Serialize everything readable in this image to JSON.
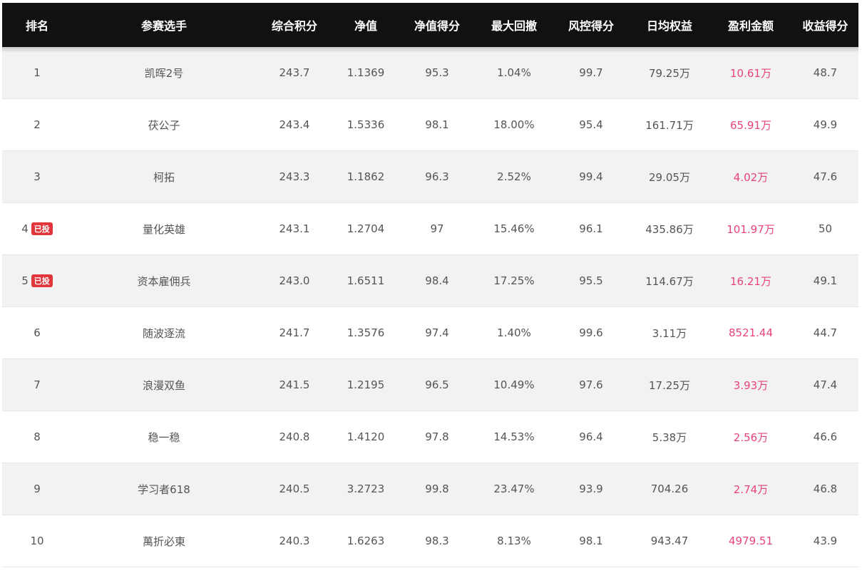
{
  "columns": [
    "排名",
    "参赛选手",
    "综合积分",
    "净值",
    "净值得分",
    "最大回撤",
    "风控得分",
    "日均权益",
    "盈利金额",
    "收益得分"
  ],
  "rows": [
    {
      "rank": "1",
      "badge": "",
      "name": "凯晖2号",
      "score": "243.7",
      "nav": "1.1369",
      "nav_score": "95.3",
      "max_dd": "1.04%",
      "risk_score": "99.7",
      "avg_equity": "79.25万",
      "profit": "10.61万",
      "return_score": "48.7"
    },
    {
      "rank": "2",
      "badge": "",
      "name": "茯公子",
      "score": "243.4",
      "nav": "1.5336",
      "nav_score": "98.1",
      "max_dd": "18.00%",
      "risk_score": "95.4",
      "avg_equity": "161.71万",
      "profit": "65.91万",
      "return_score": "49.9"
    },
    {
      "rank": "3",
      "badge": "",
      "name": "柯拓",
      "score": "243.3",
      "nav": "1.1862",
      "nav_score": "96.3",
      "max_dd": "2.52%",
      "risk_score": "99.4",
      "avg_equity": "29.05万",
      "profit": "4.02万",
      "return_score": "47.6"
    },
    {
      "rank": "4",
      "badge": "已投",
      "name": "量化英雄",
      "score": "243.1",
      "nav": "1.2704",
      "nav_score": "97",
      "max_dd": "15.46%",
      "risk_score": "96.1",
      "avg_equity": "435.86万",
      "profit": "101.97万",
      "return_score": "50"
    },
    {
      "rank": "5",
      "badge": "已投",
      "name": "资本雇佣兵",
      "score": "243.0",
      "nav": "1.6511",
      "nav_score": "98.4",
      "max_dd": "17.25%",
      "risk_score": "95.5",
      "avg_equity": "114.67万",
      "profit": "16.21万",
      "return_score": "49.1"
    },
    {
      "rank": "6",
      "badge": "",
      "name": "随波逐流",
      "score": "241.7",
      "nav": "1.3576",
      "nav_score": "97.4",
      "max_dd": "1.40%",
      "risk_score": "99.6",
      "avg_equity": "3.11万",
      "profit": "8521.44",
      "return_score": "44.7"
    },
    {
      "rank": "7",
      "badge": "",
      "name": "浪漫双鱼",
      "score": "241.5",
      "nav": "1.2195",
      "nav_score": "96.5",
      "max_dd": "10.49%",
      "risk_score": "97.6",
      "avg_equity": "17.25万",
      "profit": "3.93万",
      "return_score": "47.4"
    },
    {
      "rank": "8",
      "badge": "",
      "name": "稳一稳",
      "score": "240.8",
      "nav": "1.4120",
      "nav_score": "97.8",
      "max_dd": "14.53%",
      "risk_score": "96.4",
      "avg_equity": "5.38万",
      "profit": "2.56万",
      "return_score": "46.6"
    },
    {
      "rank": "9",
      "badge": "",
      "name": "学习者618",
      "score": "240.5",
      "nav": "3.2723",
      "nav_score": "99.8",
      "max_dd": "23.47%",
      "risk_score": "93.9",
      "avg_equity": "704.26",
      "profit": "2.74万",
      "return_score": "46.8"
    },
    {
      "rank": "10",
      "badge": "",
      "name": "萬折必東",
      "score": "240.3",
      "nav": "1.6263",
      "nav_score": "98.3",
      "max_dd": "8.13%",
      "risk_score": "98.1",
      "avg_equity": "943.47",
      "profit": "4979.51",
      "return_score": "43.9"
    }
  ],
  "colors": {
    "header_bg": "#111111",
    "row_alt_bg": "#f2f2f2",
    "profit_text": "#e8437f",
    "badge_bg": "#e0363c"
  }
}
